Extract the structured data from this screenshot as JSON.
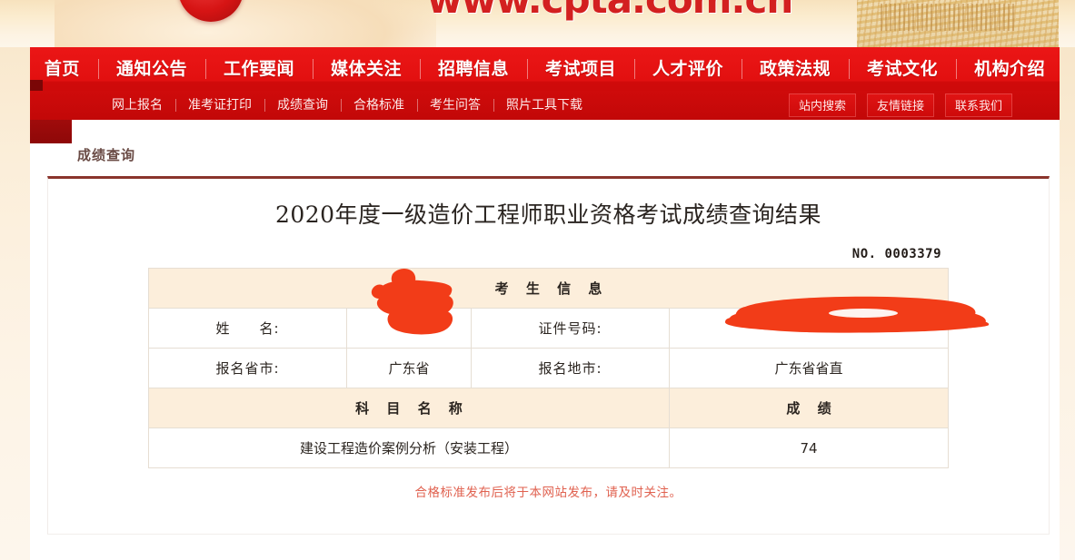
{
  "banner": {
    "url_text": "www.cpta.com.cn"
  },
  "nav": {
    "primary": [
      {
        "label": "首页"
      },
      {
        "label": "通知公告"
      },
      {
        "label": "工作要闻"
      },
      {
        "label": "媒体关注"
      },
      {
        "label": "招聘信息"
      },
      {
        "label": "考试项目"
      },
      {
        "label": "人才评价"
      },
      {
        "label": "政策法规"
      },
      {
        "label": "考试文化"
      },
      {
        "label": "机构介绍"
      }
    ],
    "secondary_left": [
      {
        "label": "网上报名"
      },
      {
        "label": "准考证打印"
      },
      {
        "label": "成绩查询"
      },
      {
        "label": "合格标准"
      },
      {
        "label": "考生问答"
      },
      {
        "label": "照片工具下载"
      }
    ],
    "secondary_right": [
      {
        "label": "站内搜索"
      },
      {
        "label": "友情链接"
      },
      {
        "label": "联系我们"
      }
    ]
  },
  "breadcrumb": {
    "current": "成绩查询"
  },
  "result": {
    "title": "2020年度一级造价工程师职业资格考试成绩查询结果",
    "serial_no": "NO. 0003379",
    "candidate_section_header": "考 生 信 息",
    "rows": [
      {
        "label_left": "姓　　名:",
        "value_left": "",
        "label_right": "证件号码:",
        "value_right": ""
      },
      {
        "label_left": "报名省市:",
        "value_left": "广东省",
        "label_right": "报名地市:",
        "value_right": "广东省省直"
      }
    ],
    "subject_header": "科 目 名 称",
    "score_header": "成 绩",
    "subjects": [
      {
        "name": "建设工程造价案例分析（安装工程）",
        "score": "74"
      }
    ],
    "footnote": "合格标准发布后将于本网站发布，请及时关注。"
  },
  "colors": {
    "nav_red": "#e21010",
    "subnav_red": "#c60909",
    "panel_border": "#8a342c",
    "table_header_bg": "#fceedb",
    "footnote_red": "#e0614f",
    "redaction_red": "#f23c18"
  }
}
